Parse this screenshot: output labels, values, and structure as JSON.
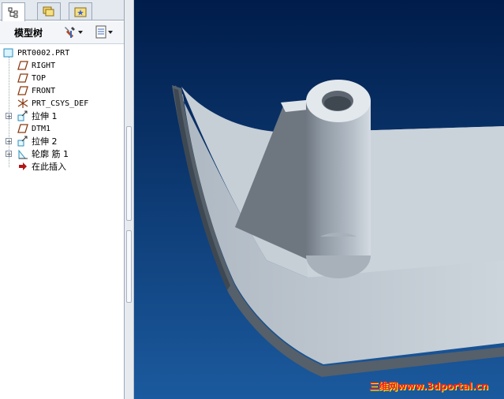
{
  "panel": {
    "tabs": [
      {
        "name": "model-tree-tab",
        "icon": "tree-icon"
      },
      {
        "name": "folder-browser-tab",
        "icon": "folders-icon"
      },
      {
        "name": "favorites-tab",
        "icon": "star-icon"
      }
    ],
    "toolbar": {
      "label": "模型树",
      "settings_icon": "tools-icon",
      "show_icon": "document-list-icon"
    }
  },
  "tree": {
    "root": "PRT0002.PRT",
    "items": [
      {
        "label": "RIGHT",
        "icon": "datum-plane-icon"
      },
      {
        "label": "TOP",
        "icon": "datum-plane-icon"
      },
      {
        "label": "FRONT",
        "icon": "datum-plane-icon"
      },
      {
        "label": "PRT_CSYS_DEF",
        "icon": "csys-icon"
      },
      {
        "label": "拉伸 1",
        "icon": "extrude-icon",
        "expandable": true
      },
      {
        "label": "DTM1",
        "icon": "datum-plane-icon"
      },
      {
        "label": "拉伸 2",
        "icon": "extrude-icon",
        "expandable": true
      },
      {
        "label": "轮廓 筋 1",
        "icon": "rib-icon",
        "expandable": true
      },
      {
        "label": "在此插入",
        "icon": "insert-arrow-icon"
      }
    ]
  },
  "viewport": {
    "background_top": "#001c4a",
    "background_bottom": "#1b5a9e",
    "part_color": "#c3cbd3"
  },
  "watermark": "三维网www.3dportal.cn"
}
